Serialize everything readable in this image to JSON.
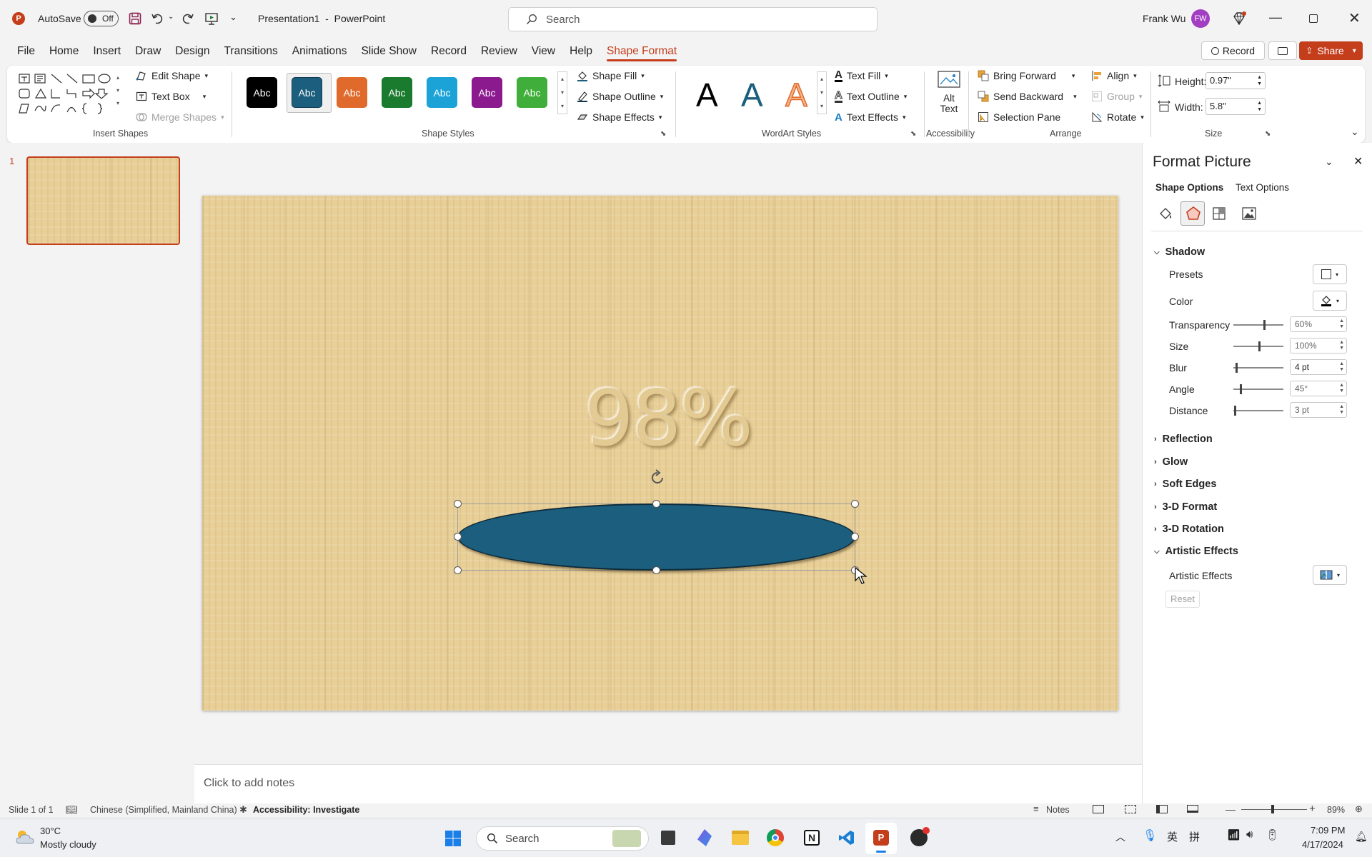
{
  "titlebar": {
    "autosave_label": "AutoSave",
    "autosave_state": "Off",
    "doc_title": "Presentation1  -  PowerPoint",
    "search_placeholder": "Search",
    "user_name": "Frank Wu",
    "user_initials": "FW"
  },
  "tabs": [
    "File",
    "Home",
    "Insert",
    "Draw",
    "Design",
    "Transitions",
    "Animations",
    "Slide Show",
    "Record",
    "Review",
    "View",
    "Help",
    "Shape Format"
  ],
  "active_tab": "Shape Format",
  "top_right": {
    "record_label": "Record",
    "share_label": "Share"
  },
  "ribbon": {
    "insert_shapes": {
      "label": "Insert Shapes",
      "edit_shape": "Edit Shape",
      "text_box": "Text Box",
      "merge_shapes": "Merge Shapes"
    },
    "shape_styles": {
      "label": "Shape Styles",
      "swatch_text": "Abc",
      "swatches": [
        "#000000",
        "#1b5e7e",
        "#e06a2b",
        "#1a7a2e",
        "#1ba3d8",
        "#8b1a8f",
        "#3fae3a"
      ],
      "shape_fill": "Shape Fill",
      "shape_outline": "Shape Outline",
      "shape_effects": "Shape Effects"
    },
    "wordart_styles": {
      "label": "WordArt Styles",
      "letter": "A",
      "text_fill": "Text Fill",
      "text_outline": "Text Outline",
      "text_effects": "Text Effects"
    },
    "accessibility": {
      "label": "Accessibility",
      "alt_text_line1": "Alt",
      "alt_text_line2": "Text"
    },
    "arrange": {
      "label": "Arrange",
      "bring_forward": "Bring Forward",
      "send_backward": "Send Backward",
      "selection_pane": "Selection Pane",
      "align": "Align",
      "group": "Group",
      "rotate": "Rotate"
    },
    "size": {
      "label": "Size",
      "height_label": "Height:",
      "height_value": "0.97\"",
      "width_label": "Width:",
      "width_value": "5.8\""
    }
  },
  "thumbnails": {
    "slide_number": "1"
  },
  "slide": {
    "big_text": "98%",
    "ellipse_color": "#1b5e7e"
  },
  "notes_placeholder": "Click to add notes",
  "format_pane": {
    "title": "Format Picture",
    "tab_shape": "Shape Options",
    "tab_text": "Text Options",
    "shadow": {
      "heading": "Shadow",
      "presets": "Presets",
      "color": "Color",
      "transparency_label": "Transparency",
      "transparency_value": "60%",
      "transparency_level": 0.6,
      "size_label": "Size",
      "size_value": "100%",
      "size_level": 0.5,
      "blur_label": "Blur",
      "blur_value": "4 pt",
      "blur_level": 0.04,
      "angle_label": "Angle",
      "angle_value": "45°",
      "angle_level": 0.125,
      "distance_label": "Distance",
      "distance_value": "3 pt",
      "distance_level": 0.02
    },
    "sections": [
      "Reflection",
      "Glow",
      "Soft Edges",
      "3-D Format",
      "3-D Rotation"
    ],
    "artistic": {
      "heading": "Artistic Effects",
      "label": "Artistic Effects",
      "reset": "Reset"
    }
  },
  "statusbar": {
    "slide_info": "Slide 1 of 1",
    "language": "Chinese (Simplified, Mainland China)",
    "accessibility": "Accessibility: Investigate",
    "notes": "Notes",
    "zoom": "89%"
  },
  "taskbar": {
    "temperature": "30°C",
    "weather": "Mostly cloudy",
    "search": "Search",
    "time": "7:09 PM",
    "date": "4/17/2024",
    "ime1": "英",
    "ime2": "拼"
  },
  "colors": {
    "accent": "#c43e1c",
    "share_bg": "#c43e1c",
    "selection_border": "#c43e1c"
  }
}
